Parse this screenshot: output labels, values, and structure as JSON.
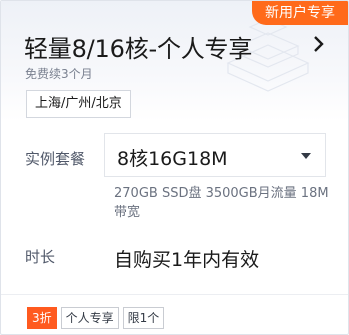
{
  "promo": {
    "label": "新用户专享"
  },
  "product": {
    "title": "轻量8/16核-个人专享",
    "subtitle": "免费续3个月",
    "region": "上海/广州/北京"
  },
  "spec": {
    "label": "实例套餐",
    "selected": "8核16G18M",
    "description": "270GB SSD盘 3500GB月流量 18M带宽"
  },
  "duration": {
    "label": "时长",
    "value": "自购买1年内有效"
  },
  "tags": {
    "discount": "3折",
    "personal": "个人专享",
    "limit": "限1个"
  },
  "colors": {
    "accent": "#ff6a1a",
    "discount": "#ff5a1f",
    "title": "#1a1a1a",
    "muted": "#7a8190"
  },
  "icons": {
    "title_arrow": "chevron-right-icon",
    "select_caret": "caret-down-icon"
  }
}
